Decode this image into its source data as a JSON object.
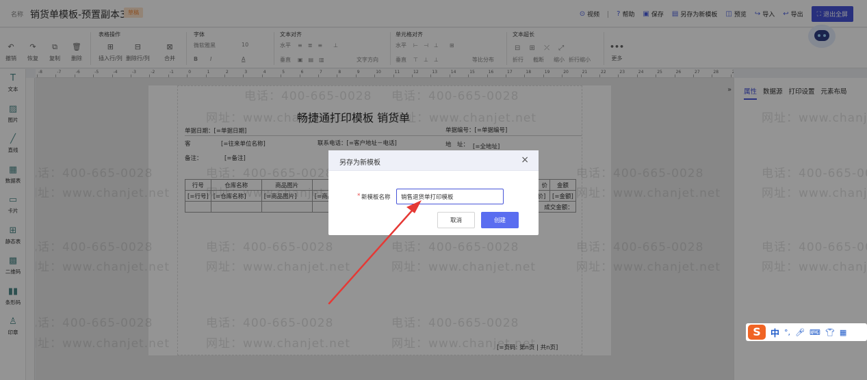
{
  "topbar": {
    "name_label": "名称",
    "title": "销货单模板-预置副本3",
    "badge": "草稿",
    "actions": [
      {
        "icon": "video-icon",
        "glyph": "⊙",
        "label": "视频"
      },
      {
        "icon": "help-icon",
        "glyph": "?",
        "label": "帮助"
      },
      {
        "icon": "save-icon",
        "glyph": "▣",
        "label": "保存"
      },
      {
        "icon": "save-as-icon",
        "glyph": "▤",
        "label": "另存为新模板"
      },
      {
        "icon": "preview-icon",
        "glyph": "◫",
        "label": "预览"
      },
      {
        "icon": "import-icon",
        "glyph": "↪",
        "label": "导入"
      },
      {
        "icon": "export-icon",
        "glyph": "↩",
        "label": "导出"
      }
    ],
    "fullscreen_label": "退出全屏"
  },
  "toolbar": {
    "basic": {
      "undo": "撤销",
      "redo": "恢复",
      "copy": "复制",
      "delete": "删除"
    },
    "table_ops": {
      "title": "表格操作",
      "insert_row": "插入行/列",
      "delete_row": "删除行/列",
      "merge": "合并"
    },
    "font": {
      "title": "字体",
      "family": "微软雅黑",
      "size": "10",
      "bold": "B",
      "italic": "I",
      "color_glyph": "A"
    },
    "text_align": {
      "title": "文本对齐",
      "horizontal": "水平",
      "vertical": "垂直",
      "direction": "文字方向"
    },
    "cell_align": {
      "title": "单元格对齐",
      "horizontal": "水平",
      "vertical": "垂直",
      "distribute": "等比分布"
    },
    "overflow": {
      "title": "文本超长",
      "wrap": "折行",
      "truncate": "截断",
      "shrink": "缩小",
      "wrap_shrink": "折行缩小"
    },
    "more": "更多"
  },
  "ruler_labels": [
    "-8",
    "-7",
    "-6",
    "-5",
    "-4",
    "-3",
    "-2",
    "-1",
    "0",
    "1",
    "2",
    "3",
    "4",
    "5",
    "6",
    "7",
    "8",
    "9",
    "10",
    "11",
    "12",
    "13",
    "14",
    "15",
    "16",
    "17",
    "18",
    "19",
    "20",
    "21",
    "22",
    "23",
    "24",
    "25",
    "26",
    "27",
    "28",
    "29",
    "30",
    "31",
    "32",
    "33",
    "34",
    "35",
    "36",
    "37"
  ],
  "leftbar": [
    {
      "icon": "text-icon",
      "glyph": "T",
      "label": "文本"
    },
    {
      "icon": "image-icon",
      "glyph": "▨",
      "label": "图片"
    },
    {
      "icon": "line-icon",
      "glyph": "╱",
      "label": "直线"
    },
    {
      "icon": "data-table-icon",
      "glyph": "▦",
      "label": "数据表"
    },
    {
      "icon": "card-icon",
      "glyph": "▭",
      "label": "卡片"
    },
    {
      "icon": "static-table-icon",
      "glyph": "⊞",
      "label": "静态表"
    },
    {
      "icon": "qrcode-icon",
      "glyph": "▩",
      "label": "二维码"
    },
    {
      "icon": "barcode-icon",
      "glyph": "▮▮",
      "label": "条形码"
    },
    {
      "icon": "stamp-icon",
      "glyph": "♙",
      "label": "印章"
    }
  ],
  "paper": {
    "title": "畅捷通打印模板 销货单",
    "date_field": "单据日期：[=单据日期]",
    "customer_label": "客",
    "customer_field": "[=往来单位名称]",
    "phone_field": "联系电话：[=客户地址－电话]",
    "doc_no_field": "单据编号：[=单据编号]",
    "address_label": "地　址：",
    "address_field": "[=全地址]",
    "note_label": "备注：",
    "note_field": "[=备注]",
    "table_headers": [
      "行号",
      "仓库名称",
      "商品图片",
      ""
    ],
    "table_row": [
      "[=行号]",
      "[=仓库名称]",
      "[=商品图片]",
      "[=商品"
    ],
    "right_headers": [
      "价",
      "金额"
    ],
    "right_row": [
      "单价]",
      "[=金额]"
    ],
    "total_label": "成交金额：",
    "footer": "[=页码: 第n页 | 共n页]"
  },
  "rightpanel": {
    "toggle": "»",
    "tabs": [
      {
        "label": "属性",
        "active": true
      },
      {
        "label": "数据源",
        "active": false
      },
      {
        "label": "打印设置",
        "active": false
      },
      {
        "label": "元素布局",
        "active": false
      }
    ]
  },
  "watermark": {
    "phone": "电话：400-665-0028",
    "site": "网址：www.chanjet.net"
  },
  "dialog": {
    "title": "另存为新模板",
    "close": "×",
    "required_mark": "*",
    "field_label": "新模板名称",
    "field_value": "销售退货单打印模板",
    "cancel": "取消",
    "create": "创建"
  },
  "ime": {
    "logo": "S",
    "mode": "中",
    "punct": "°,",
    "icons": [
      "mic-icon",
      "keyboard-icon",
      "shirt-icon",
      "apps-icon"
    ]
  },
  "colors": {
    "accent": "#4654d8",
    "create_button": "#5a6df0",
    "arrow": "#e53935",
    "badge": "#f08a3c"
  }
}
